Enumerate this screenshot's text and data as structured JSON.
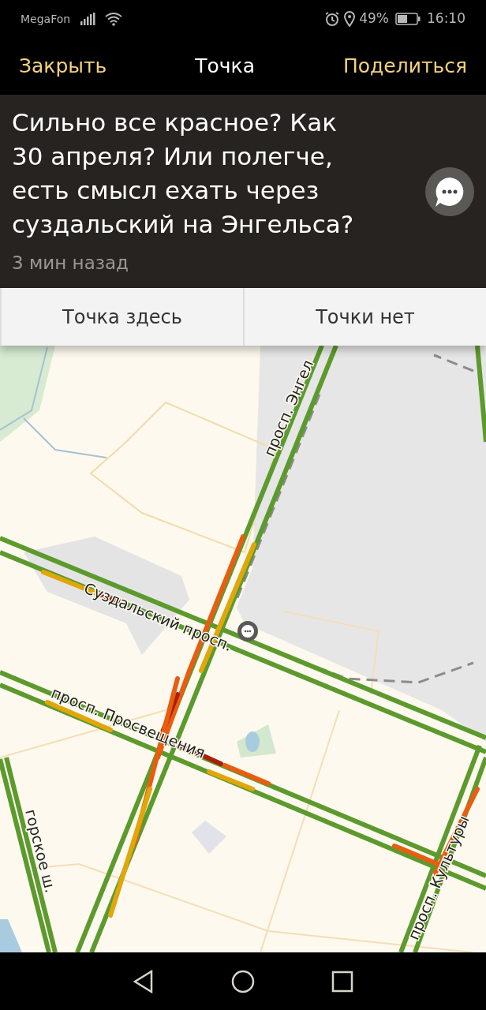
{
  "status_bar": {
    "carrier": "MegaFon",
    "battery": "49%",
    "time": "16:10"
  },
  "header": {
    "close": "Закрыть",
    "title": "Точка",
    "share": "Поделиться"
  },
  "message": {
    "text": "Сильно все красное? Как 30 апреля? Или полегче, есть смысл ехать через суздальский на Энгельса?",
    "time": "3 мин назад"
  },
  "actions": [
    "Точка здесь",
    "Точки нет"
  ],
  "map": {
    "road_labels": [
      {
        "text": "просп. Энгел"
      },
      {
        "text": "Суздальский просп."
      },
      {
        "text": "просп. Просвещения"
      },
      {
        "text": "горское ш."
      },
      {
        "text": "просп. Культуры"
      }
    ]
  }
}
